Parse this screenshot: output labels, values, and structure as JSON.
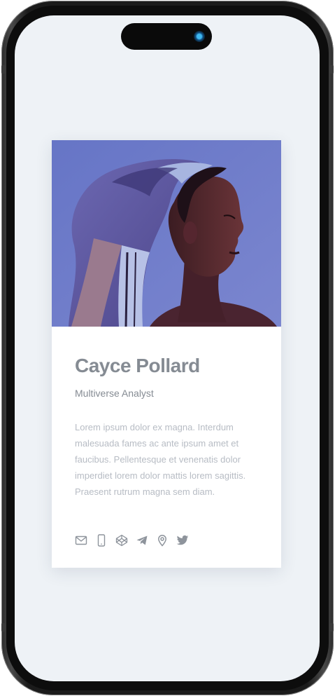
{
  "profile": {
    "name": "Cayce Pollard",
    "role": "Multiverse Analyst",
    "bio": "Lorem ipsum dolor ex magna. Interdum malesuada fames ac ante ipsum amet et faucibus. Pellentesque et venenatis dolor imperdiet lorem dolor mattis lorem sagittis. Praesent rutrum magna sem diam."
  },
  "social_icons": [
    "mail-icon",
    "phone-icon",
    "codepen-icon",
    "telegram-icon",
    "location-icon",
    "twitter-icon"
  ],
  "colors": {
    "screen_background": "#eef2f6",
    "card_background": "#ffffff",
    "name_text": "#858b93",
    "bio_text": "#b7bcc4",
    "icon": "#8e949c"
  }
}
